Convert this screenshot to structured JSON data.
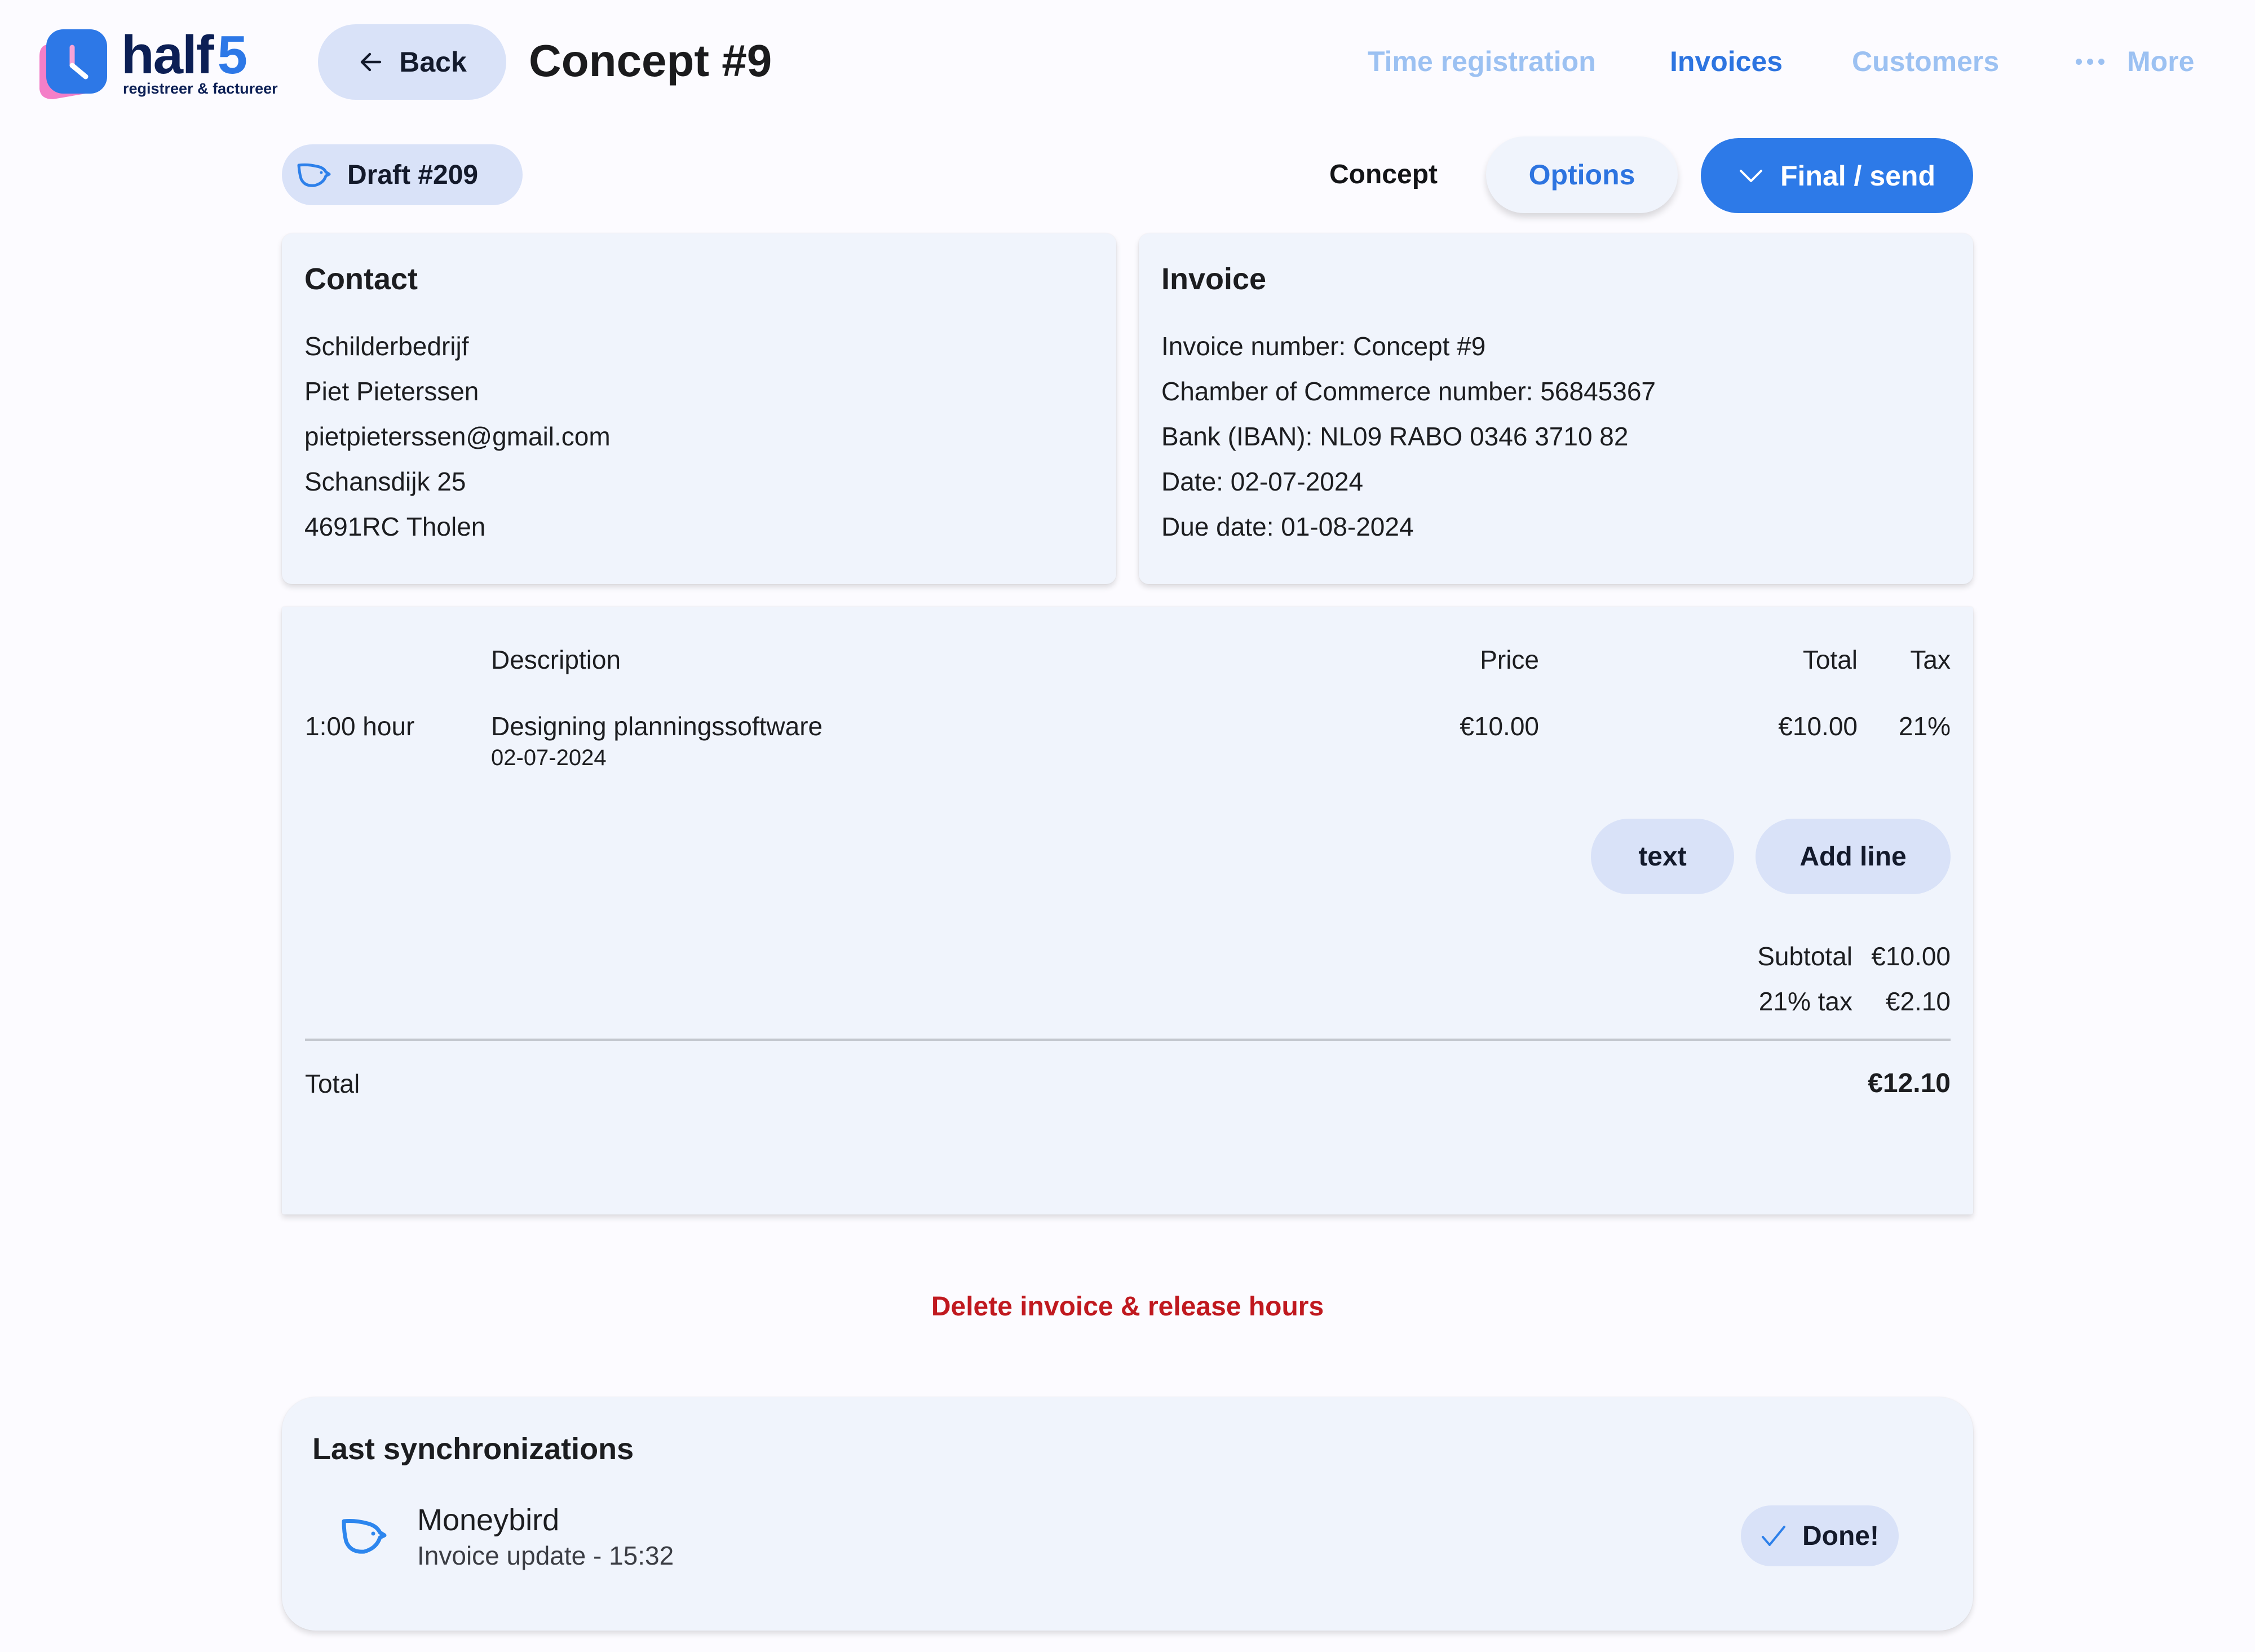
{
  "brand": {
    "name": "half",
    "name_accent": "5",
    "tagline": "registreer & factureer",
    "colors": {
      "primary": "#2d78e7",
      "navy": "#0c1f55",
      "pink": "#f47fc8"
    }
  },
  "header": {
    "back_label": "Back",
    "title": "Concept #9",
    "nav": [
      {
        "label": "Time registration",
        "active": false
      },
      {
        "label": "Invoices",
        "active": true
      },
      {
        "label": "Customers",
        "active": false
      },
      {
        "label": "More",
        "active": false,
        "icon": "more-dots-icon"
      }
    ]
  },
  "status_bar": {
    "draft_badge": "Draft #209",
    "draft_icon": "moneybird-bird-icon",
    "status": "Concept",
    "options_label": "Options",
    "final_label": "Final / send",
    "final_icon": "chevron-down-icon"
  },
  "contact": {
    "title": "Contact",
    "lines": [
      "Schilderbedrijf",
      "Piet Pieterssen",
      "pietpieterssen@gmail.com",
      "Schansdijk 25",
      "4691RC Tholen"
    ]
  },
  "invoice": {
    "title": "Invoice",
    "lines": [
      "Invoice number: Concept #9",
      "Chamber of Commerce number: 56845367",
      "Bank (IBAN): NL09 RABO 0346 3710 82",
      "Date: 02-07-2024",
      "Due date: 01-08-2024"
    ]
  },
  "lines_table": {
    "headers": {
      "description": "Description",
      "price": "Price",
      "total": "Total",
      "tax": "Tax"
    },
    "rows": [
      {
        "quantity": "1:00 hour",
        "description": "Designing planningssoftware",
        "date": "02-07-2024",
        "price": "€10.00",
        "total": "€10.00",
        "tax": "21%"
      }
    ],
    "text_button": "text",
    "add_line_button": "Add line",
    "subtotal_label": "Subtotal",
    "subtotal_value": "€10.00",
    "tax_label": "21% tax",
    "tax_value": "€2.10",
    "total_label": "Total",
    "total_value": "€12.10"
  },
  "delete_label": "Delete invoice & release hours",
  "sync": {
    "title": "Last synchronizations",
    "items": [
      {
        "service": "Moneybird",
        "detail": "Invoice update - 15:32",
        "status": "Done!"
      }
    ]
  }
}
